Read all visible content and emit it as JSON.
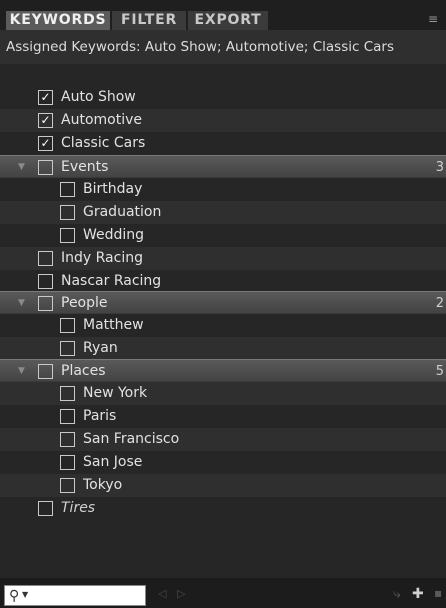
{
  "tabs": [
    {
      "label": "KEYWORDS",
      "active": true
    },
    {
      "label": "FILTER",
      "active": false
    },
    {
      "label": "EXPORT",
      "active": false
    }
  ],
  "panel_menu_icon": "≡",
  "assigned_text": "Assigned Keywords: Auto Show; Automotive; Classic Cars",
  "rows": [
    {
      "kind": "item",
      "level": 0,
      "label": "Auto Show",
      "checked": true
    },
    {
      "kind": "item",
      "level": 0,
      "label": "Automotive",
      "checked": true
    },
    {
      "kind": "item",
      "level": 0,
      "label": "Classic Cars",
      "checked": true
    },
    {
      "kind": "group",
      "level": 0,
      "label": "Events",
      "checked": false,
      "count": "3"
    },
    {
      "kind": "item",
      "level": 1,
      "label": "Birthday",
      "checked": false
    },
    {
      "kind": "item",
      "level": 1,
      "label": "Graduation",
      "checked": false
    },
    {
      "kind": "item",
      "level": 1,
      "label": "Wedding",
      "checked": false
    },
    {
      "kind": "item",
      "level": 0,
      "label": "Indy Racing",
      "checked": false
    },
    {
      "kind": "item",
      "level": 0,
      "label": "Nascar Racing",
      "checked": false
    },
    {
      "kind": "group",
      "level": 0,
      "label": "People",
      "checked": false,
      "count": "2"
    },
    {
      "kind": "item",
      "level": 1,
      "label": "Matthew",
      "checked": false
    },
    {
      "kind": "item",
      "level": 1,
      "label": "Ryan",
      "checked": false
    },
    {
      "kind": "group",
      "level": 0,
      "label": "Places",
      "checked": false,
      "count": "5"
    },
    {
      "kind": "item",
      "level": 1,
      "label": "New York",
      "checked": false
    },
    {
      "kind": "item",
      "level": 1,
      "label": "Paris",
      "checked": false
    },
    {
      "kind": "item",
      "level": 1,
      "label": "San Francisco",
      "checked": false
    },
    {
      "kind": "item",
      "level": 1,
      "label": "San Jose",
      "checked": false
    },
    {
      "kind": "item",
      "level": 1,
      "label": "Tokyo",
      "checked": false
    },
    {
      "kind": "item",
      "level": 0,
      "label": "Tires",
      "checked": false,
      "italic": true
    }
  ],
  "bottom": {
    "search_icon": "search-icon",
    "prev_icon": "◁",
    "next_icon": "▷",
    "new_child_icon": "⤷",
    "new_icon": "✚",
    "delete_icon": "🗑"
  }
}
